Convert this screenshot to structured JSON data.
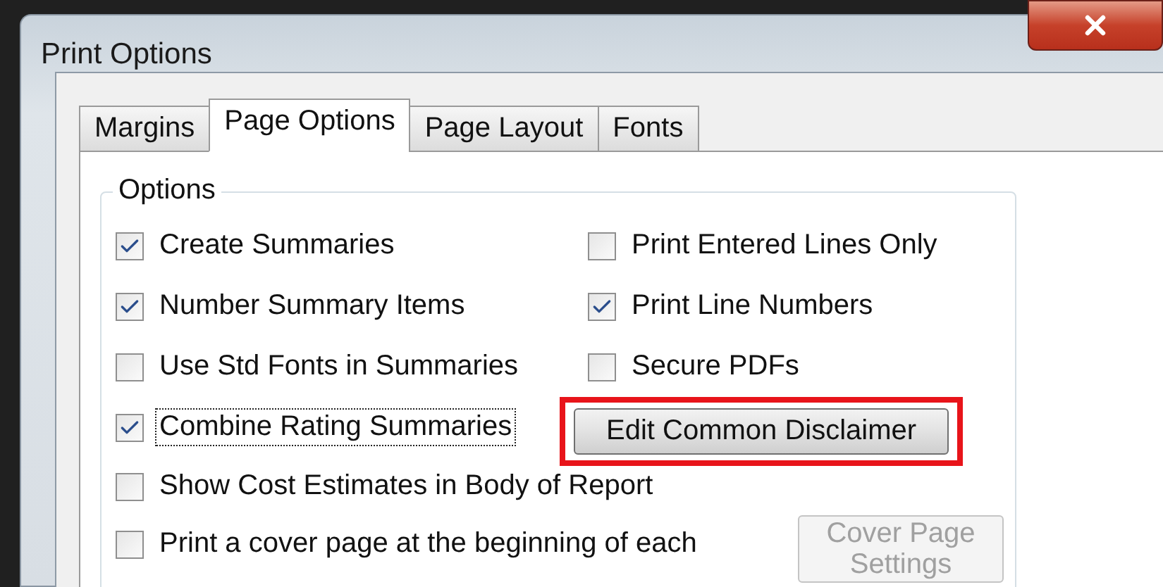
{
  "window": {
    "title": "Print Options"
  },
  "tabs": [
    {
      "label": "Margins",
      "selected": false
    },
    {
      "label": "Page Options",
      "selected": true
    },
    {
      "label": "Page Layout",
      "selected": false
    },
    {
      "label": "Fonts",
      "selected": false
    }
  ],
  "options_group": {
    "title": "Options",
    "left_options": [
      {
        "label": "Create Summaries",
        "checked": true,
        "focused": false
      },
      {
        "label": "Number Summary Items",
        "checked": true,
        "focused": false
      },
      {
        "label": "Use Std Fonts in Summaries",
        "checked": false,
        "focused": false
      },
      {
        "label": "Combine Rating Summaries",
        "checked": true,
        "focused": true
      }
    ],
    "right_options": [
      {
        "label": "Print Entered Lines Only",
        "checked": false
      },
      {
        "label": "Print Line Numbers",
        "checked": true
      },
      {
        "label": "Secure PDFs",
        "checked": false
      }
    ],
    "disclaimer_button": {
      "label": "Edit Common Disclaimer",
      "highlighted": true
    },
    "wide_options": [
      {
        "label": "Show Cost Estimates in Body of Report",
        "checked": false
      },
      {
        "label": "Print a cover page at the beginning of each",
        "checked": false
      }
    ],
    "cover_button": {
      "label": "Cover Page Settings",
      "disabled": true
    }
  }
}
